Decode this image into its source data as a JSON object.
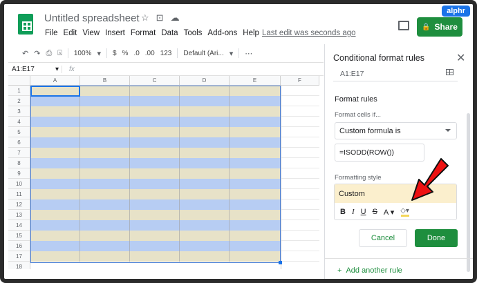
{
  "badge": "alphr",
  "header": {
    "title": "Untitled spreadsheet",
    "menu": [
      "File",
      "Edit",
      "View",
      "Insert",
      "Format",
      "Data",
      "Tools",
      "Add-ons",
      "Help"
    ],
    "last_edit": "Last edit was seconds ago",
    "share_label": "Share",
    "brand_color": "#1e8e3e"
  },
  "toolbar": {
    "zoom": "100%",
    "currency": "$",
    "percent": "%",
    "decrease_decimals": ".0",
    "increase_decimals": ".00",
    "number_format": "123",
    "font": "Default (Ari..."
  },
  "formula_bar": {
    "name_box": "A1:E17",
    "fx": "fx"
  },
  "grid": {
    "columns": [
      "A",
      "B",
      "C",
      "D",
      "E",
      "F"
    ],
    "rows": [
      "1",
      "2",
      "3",
      "4",
      "5",
      "6",
      "7",
      "8",
      "9",
      "10",
      "11",
      "12",
      "13",
      "14",
      "15",
      "16",
      "17",
      "18"
    ],
    "odd_row_color": "#e7e2c8",
    "even_row_color": "#b7cdf3"
  },
  "panel": {
    "title": "Conditional format rules",
    "range": "A1:E17",
    "section_title": "Format rules",
    "cells_if_label": "Format cells if...",
    "condition": "Custom formula is",
    "formula": "=ISODD(ROW())",
    "formatting_style_label": "Formatting style",
    "style_preview": "Custom",
    "style_buttons": [
      "B",
      "I",
      "U",
      "S",
      "A"
    ],
    "cancel_label": "Cancel",
    "done_label": "Done",
    "add_rule_label": "Add another rule",
    "add_rule_plus": "+"
  }
}
